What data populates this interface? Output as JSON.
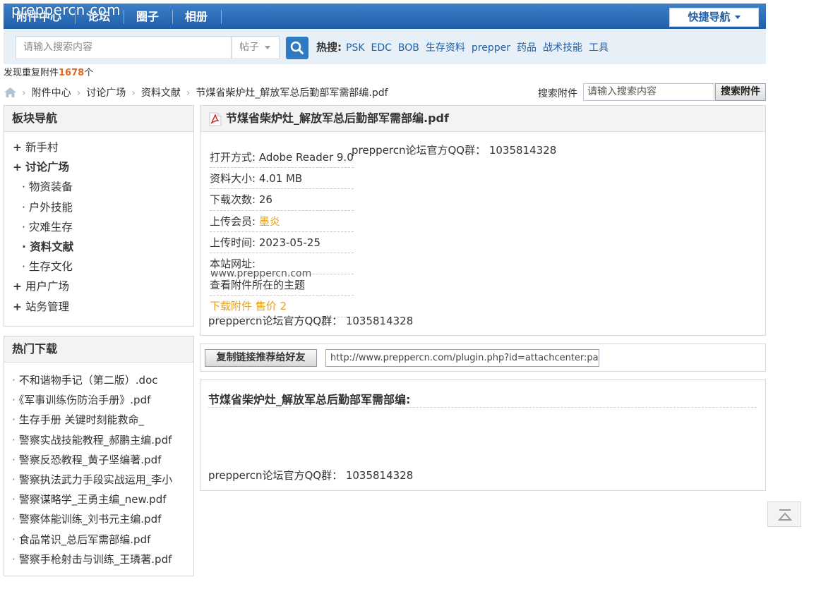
{
  "watermark": "preppercn.com",
  "topnav": {
    "items": [
      "附件中心",
      "论坛",
      "圈子",
      "相册"
    ],
    "quick_nav": "快捷导航"
  },
  "search": {
    "placeholder": "请输入搜索内容",
    "type": "帖子",
    "hot_label": "热搜:",
    "hot_terms": [
      "PSK",
      "EDC",
      "BOB",
      "生存资料",
      "prepper",
      "药品",
      "战术技能",
      "工具"
    ]
  },
  "dup_notice": {
    "prefix": "发现重复附件",
    "count": "1678",
    "suffix": "个"
  },
  "breadcrumb": [
    "附件中心",
    "讨论广场",
    "资料文献",
    "节煤省柴炉灶_解放军总后勤部军需部编.pdf"
  ],
  "attachment_search": {
    "label": "搜索附件",
    "placeholder": "请输入搜索内容",
    "button": "搜索附件"
  },
  "sidebar": {
    "title": "板块导航",
    "items": [
      {
        "label": "新手村",
        "kind": "group"
      },
      {
        "label": "讨论广场",
        "kind": "group-active"
      },
      {
        "label": "物资装备",
        "kind": "sub"
      },
      {
        "label": "户外技能",
        "kind": "sub"
      },
      {
        "label": "灾难生存",
        "kind": "sub"
      },
      {
        "label": "资料文献",
        "kind": "sub-active"
      },
      {
        "label": "生存文化",
        "kind": "sub"
      },
      {
        "label": "用户广场",
        "kind": "group"
      },
      {
        "label": "站务管理",
        "kind": "group"
      }
    ]
  },
  "hot_downloads": {
    "title": "热门下载",
    "items": [
      "不和谐物手记（第二版）.doc",
      "《军事训练伤防治手册》.pdf",
      "生存手册 关键时刻能救命_",
      "警察实战技能教程_郝鹏主编.pdf",
      "警察反恐教程_黄子坚编著.pdf",
      "警察执法武力手段实战运用_李小",
      "警察谋略学_王勇主编_new.pdf",
      "警察体能训练_刘书元主编.pdf",
      "食品常识_总后军需部编.pdf",
      "警察手枪射击与训练_王璘著.pdf"
    ]
  },
  "file": {
    "title": "节煤省柴炉灶_解放军总后勤部军需部编.pdf",
    "open_with": "打开方式: Adobe Reader 9.0",
    "qq_right": "preppercn论坛官方QQ群： 1035814328",
    "size": "资料大小: 4.01 MB",
    "downloads": "下载次数: 26",
    "uploader_label": "上传会员: ",
    "uploader": "墨炎",
    "upload_time": "上传时间: 2023-05-25",
    "site_label": "本站网址:",
    "site_url": "www.preppercn.com",
    "view_thread": "查看附件所在的主题",
    "download_link": "下载附件 售价 2",
    "qq_bottom": "preppercn论坛官方QQ群： 1035814328"
  },
  "share": {
    "button": "复制链接推荐给好友",
    "url": "http://www.preppercn.com/plugin.php?id=attachcenter:page&a"
  },
  "description": {
    "title": "节煤省柴炉灶_解放军总后勤部军需部编:",
    "qq": "preppercn论坛官方QQ群： 1035814328"
  },
  "colors": {
    "nav_blue": "#2a6db6",
    "link_blue": "#2060a8",
    "accent_orange": "#e6a01c",
    "count_orange": "#e26a1d"
  }
}
